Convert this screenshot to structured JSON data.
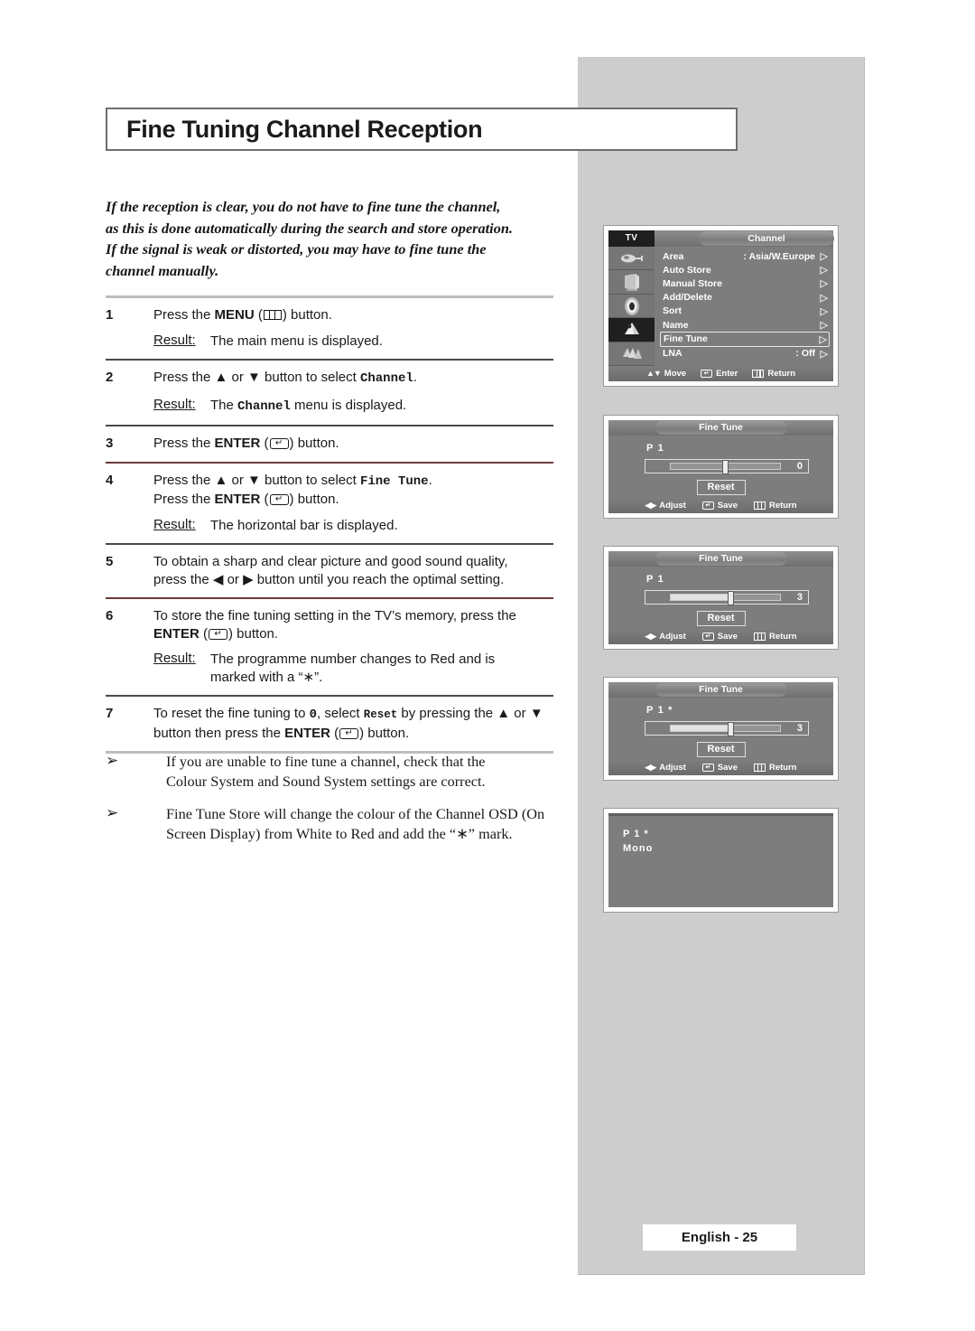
{
  "page": {
    "title": "Fine Tuning Channel Reception",
    "footer": "English - 25"
  },
  "intro": {
    "line1": "If the reception is clear, you do not have to fine tune the channel,",
    "line2": "as this is done automatically during the search and store operation.",
    "line3": "If the signal is weak or distorted, you may have to fine tune the",
    "line4": "channel manually."
  },
  "steps": [
    {
      "num": "1",
      "pre": "Press the ",
      "key": "MENU",
      "post": " button.",
      "result_label": "Result:",
      "result_pre": "The main menu is displayed.",
      "result_mono": "",
      "result_post": ""
    },
    {
      "num": "2",
      "pre": "Press the ▲ or ▼ button to select ",
      "mono": "Channel",
      "post": ".",
      "result_label": "Result:",
      "result_pre": "The ",
      "result_mono": "Channel",
      "result_post": " menu is displayed."
    },
    {
      "num": "3",
      "pre": "Press the ",
      "key": "ENTER",
      "post": " button."
    },
    {
      "num": "4",
      "pre": "Press the ▲ or ▼ button to select ",
      "mono": "Fine Tune",
      "post": ".",
      "line2_pre": "Press the ",
      "line2_key": "ENTER",
      "line2_post": " button.",
      "result_label": "Result:",
      "result_pre": "The horizontal bar is displayed."
    },
    {
      "num": "5",
      "line1": "To obtain a sharp and clear picture and good sound quality,",
      "line2": "press the ◀ or ▶ button until you reach the optimal setting."
    },
    {
      "num": "6",
      "line1": "To store the fine tuning setting in the TV’s memory, press the",
      "line2_key": "ENTER",
      "line2_post": " button.",
      "result_label": "Result:",
      "result_line1": "The programme number changes to Red and is",
      "result_line2": "marked with a “∗”."
    },
    {
      "num": "7",
      "seg1": "To reset the fine tuning to ",
      "seg2_mono": "0",
      "seg3": ", select ",
      "seg4_mono": "Reset",
      "seg5": " by pressing the ▲ or ▼",
      "line2_pre": "button then press the ",
      "line2_key": "ENTER",
      "line2_post": " button."
    }
  ],
  "bullets": [
    {
      "mark": "➢",
      "line1": "If you are unable to fine tune a channel, check that the",
      "line2": "Colour System and Sound System settings are correct."
    },
    {
      "mark": "➢",
      "line1": "Fine Tune Store will change the colour of the Channel OSD (On",
      "line2": "Screen Display) from White to Red and add the “∗” mark."
    }
  ],
  "osd_channel": {
    "source_label": "TV",
    "tab_title": "Channel",
    "items": [
      {
        "label": "Area",
        "value": ": Asia/W.Europe",
        "caret": "▷",
        "selected": false
      },
      {
        "label": "Auto Store",
        "value": "",
        "caret": "▷",
        "selected": false
      },
      {
        "label": "Manual Store",
        "value": "",
        "caret": "▷",
        "selected": false
      },
      {
        "label": "Add/Delete",
        "value": "",
        "caret": "▷",
        "selected": false
      },
      {
        "label": "Sort",
        "value": "",
        "caret": "▷",
        "selected": false
      },
      {
        "label": "Name",
        "value": "",
        "caret": "▷",
        "selected": false
      },
      {
        "label": "Fine Tune",
        "value": "",
        "caret": "▷",
        "selected": true
      },
      {
        "label": "LNA",
        "value": ": Off",
        "caret": "▷",
        "selected": false
      }
    ],
    "icons": [
      {
        "name": "input-source-icon",
        "selected": false
      },
      {
        "name": "picture-icon",
        "selected": false
      },
      {
        "name": "sound-icon",
        "selected": false
      },
      {
        "name": "channel-icon",
        "selected": true
      },
      {
        "name": "setup-icon",
        "selected": false
      }
    ],
    "hints": {
      "move": "Move",
      "enter": "Enter",
      "return": "Return"
    }
  },
  "osd_finetune": [
    {
      "tab_title": "Fine Tune",
      "programme": "P  1",
      "value": "0",
      "fill_percent": 0,
      "handle_percent": 50,
      "reset_label": "Reset",
      "hints": {
        "adjust": "Adjust",
        "save": "Save",
        "return": "Return"
      }
    },
    {
      "tab_title": "Fine Tune",
      "programme": "P  1",
      "value": "3",
      "fill_percent": 52,
      "handle_percent": 55,
      "reset_label": "Reset",
      "hints": {
        "adjust": "Adjust",
        "save": "Save",
        "return": "Return"
      }
    },
    {
      "tab_title": "Fine Tune",
      "programme": "P  1  *",
      "value": "3",
      "fill_percent": 52,
      "handle_percent": 55,
      "reset_label": "Reset",
      "hints": {
        "adjust": "Adjust",
        "save": "Save",
        "return": "Return"
      }
    }
  ],
  "osd_display": {
    "line1": "P  1 *",
    "line2": "Mono"
  },
  "colors": {
    "panel_grey": "#cdcdcd",
    "osd_grey": "#7d7d7d",
    "osd_dark": "#1e1e1e",
    "text": "#1a1a1a"
  }
}
